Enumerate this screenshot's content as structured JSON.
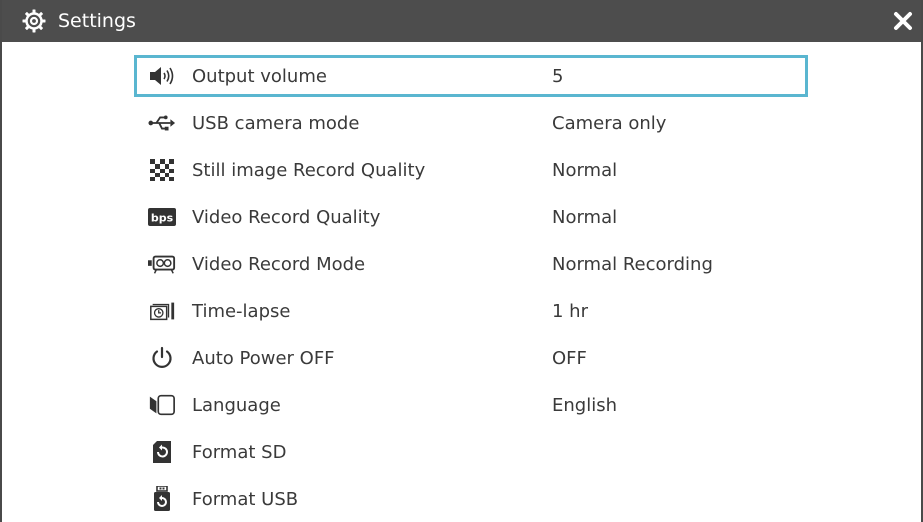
{
  "title": "Settings",
  "title_icon": "gear-icon",
  "close_icon": "close-icon",
  "accent_color": "#5ab6d0",
  "titlebar_color": "#4d4d4d",
  "items": [
    {
      "icon": "speaker-icon",
      "label": "Output volume",
      "value": "5",
      "selected": true
    },
    {
      "icon": "usb-icon",
      "label": "USB camera mode",
      "value": "Camera only"
    },
    {
      "icon": "image-quality-icon",
      "label": "Still image Record Quality",
      "value": "Normal"
    },
    {
      "icon": "bps-icon",
      "label": "Video Record Quality",
      "value": "Normal",
      "icon_text": "bps"
    },
    {
      "icon": "video-camera-icon",
      "label": "Video Record Mode",
      "value": "Normal Recording"
    },
    {
      "icon": "timelapse-icon",
      "label": "Time-lapse",
      "value": "1 hr"
    },
    {
      "icon": "power-icon",
      "label": "Auto Power OFF",
      "value": "OFF"
    },
    {
      "icon": "language-icon",
      "label": "Language",
      "value": "English"
    },
    {
      "icon": "format-sd-icon",
      "label": "Format SD",
      "value": ""
    },
    {
      "icon": "format-usb-icon",
      "label": "Format USB",
      "value": ""
    }
  ]
}
